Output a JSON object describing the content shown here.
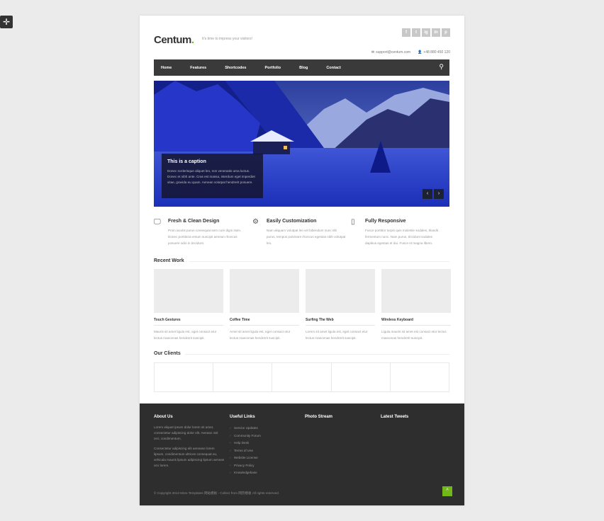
{
  "brand": {
    "logo": "Centum",
    "logo_dot": ".",
    "tagline": "It's time to impress your visitors!"
  },
  "social": [
    "f",
    "t",
    "ig",
    "in",
    "p"
  ],
  "contact": {
    "email": "support@centum.com",
    "phone": "+48 880 450 120"
  },
  "nav": {
    "items": [
      "Home",
      "Features",
      "Shortcodes",
      "Portfolio",
      "Blog",
      "Contact"
    ],
    "search_icon": "search-icon"
  },
  "slider": {
    "caption_title": "This is a caption",
    "caption_text": "Donec scelerisque aliquet leo, non venenatis urna luctus. Donec et nibh ante. Cras est massa, interdum eget imperdiet vitae, gravida eu quam. Aenean volutpat hendrerit posuere.",
    "prev": "‹",
    "next": "›"
  },
  "features": [
    {
      "icon": "monitor-icon",
      "title": "Fresh & Clean Design",
      "text": "Proin iaculis purus consequat sem cure digni ssim. Donec porttitora entum suscipit aenean rhoncus posuere odio in tincidunt."
    },
    {
      "icon": "gear-icon",
      "title": "Easily Customization",
      "text": "Nam aliquam volutpat leo vel bibendum nunc elit purus, tempus pulvinare rhoncus egestas nibh volutpat leo."
    },
    {
      "icon": "phone-icon",
      "title": "Fully Responsive",
      "text": "Fusce porttitor turpis quis molestie sodales, blandit fermentum nunc. Nam purus, tincidunt sodales dapibus egestas et dui. Fusce et magna libero."
    }
  ],
  "recent_work": {
    "title": "Recent Work",
    "items": [
      {
        "title": "Touch Gestures",
        "text": "Mauris sit amet ligula est, eget consact etur lectus maecenas hendrerit suscipit."
      },
      {
        "title": "Coffee Time",
        "text": "Amet sit amet ligula est, eget consact etur lectus maecenas hendrerit suscipit."
      },
      {
        "title": "Surfing The Web",
        "text": "Lorem sit amet ligula est, eget consact etur lectus maecenas hendrerit suscipit."
      },
      {
        "title": "Wireless Keyboard",
        "text": "Ligula mauris sit amet est consact etur lectus maecenas hendrerit suscipit."
      }
    ]
  },
  "clients": {
    "title": "Our Clients",
    "count": 5
  },
  "footer": {
    "about": {
      "title": "About Us",
      "p1": "Lorem aliquet ipsum dolor lorem sit amet, consectetur adipiscing dolor elit. Aenean nisl orci, condimentum.",
      "p2": "Consectetur adipiscing elit aeneane lorem lipsum, condimentum ultrices consequat eu, vehicula mauris lipsum adipiscing lipsum aenean orci lorem."
    },
    "links": {
      "title": "Useful Links",
      "items": [
        "Service Updates",
        "Community Forum",
        "Help Desk",
        "Terms of Use",
        "Website License",
        "Privacy Policy",
        "Knowledgebase"
      ]
    },
    "photos_title": "Photo Stream",
    "tweets_title": "Latest Tweets",
    "copyright": "© Copyright 2013 More Templates 网站模板 - Collect from 网页模板 All rights reserved.",
    "to_top": "^"
  }
}
